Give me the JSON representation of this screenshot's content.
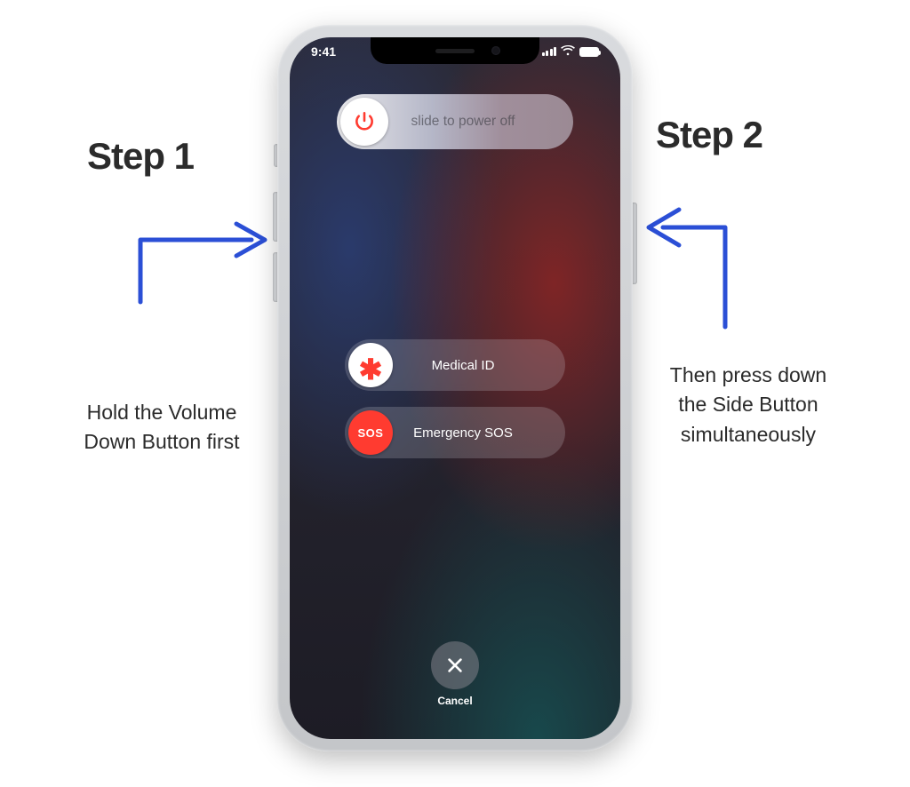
{
  "phone": {
    "status": {
      "time": "9:41"
    },
    "power_slider": {
      "label": "slide to power off"
    },
    "medical_slider": {
      "label": "Medical ID"
    },
    "sos_slider": {
      "label": "Emergency SOS",
      "knob_text": "SOS"
    },
    "cancel": {
      "label": "Cancel"
    }
  },
  "annotations": {
    "step1": {
      "title": "Step 1",
      "desc": "Hold the Volume Down Button first"
    },
    "step2": {
      "title": "Step 2",
      "desc": "Then press down the Side Button simultaneously"
    }
  }
}
